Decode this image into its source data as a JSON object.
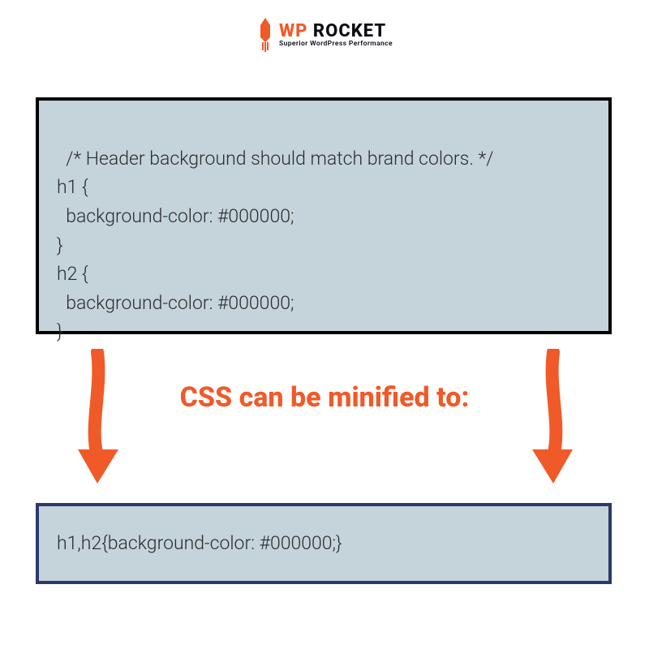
{
  "brand": {
    "name_wp": "WP",
    "name_rocket": " ROCKET",
    "tagline": "Superior WordPress Performance",
    "accent": "#f05a28"
  },
  "before_code": "/* Header background should match brand colors. */\nh1 {\n  background-color: #000000;\n}\nh2 {\n  background-color: #000000;\n}",
  "caption": "CSS can be minified to:",
  "after_code": "h1,h2{background-color: #000000;}"
}
